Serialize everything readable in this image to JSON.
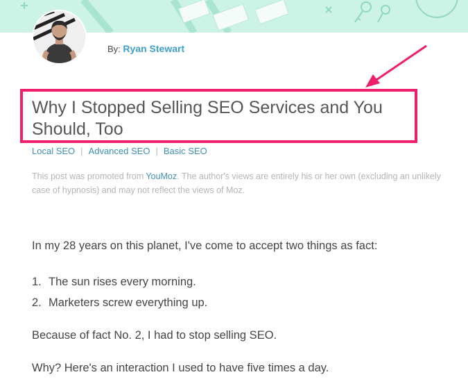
{
  "byline": {
    "prefix": "By:",
    "author": "Ryan Stewart"
  },
  "title": "Why I Stopped Selling SEO Services and You Should, Too",
  "tags": [
    "Local SEO",
    "Advanced SEO",
    "Basic SEO"
  ],
  "promo": {
    "before": "This post was promoted from ",
    "link": "YouMoz",
    "after": ". The author's views are entirely his or her own (excluding an unlikely case of hypnosis) and may not reflect the views of Moz."
  },
  "body": {
    "intro": "In my 28 years on this planet, I've come to accept two things as fact:",
    "facts": [
      {
        "num": "1.",
        "text": "The sun rises every morning."
      },
      {
        "num": "2.",
        "text": "Marketers screw everything up."
      }
    ],
    "p2": "Because of fact No. 2, I had to stop selling SEO.",
    "p3": "Why? Here's an interaction I used to have five times a day."
  },
  "colors": {
    "banner": "#cdf3e6",
    "highlight": "#ef1d6a",
    "link": "#3e9fd0"
  },
  "icons": [
    "avatar-photo",
    "arrow-icon",
    "key-icon"
  ]
}
